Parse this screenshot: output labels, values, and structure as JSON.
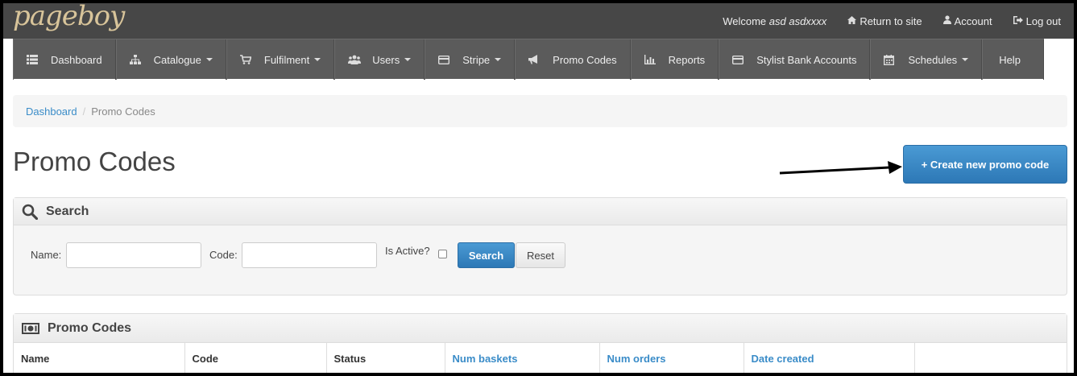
{
  "topbar": {
    "logo": "pageboy",
    "welcome_prefix": "Welcome",
    "welcome_user": "asd asdxxxx",
    "links": [
      {
        "label": "Return to site",
        "icon": "home-icon"
      },
      {
        "label": "Account",
        "icon": "user-icon"
      },
      {
        "label": "Log out",
        "icon": "logout-icon"
      }
    ]
  },
  "mainnav": [
    {
      "label": "Dashboard",
      "icon": "list-icon",
      "dropdown": false
    },
    {
      "label": "Catalogue",
      "icon": "sitemap-icon",
      "dropdown": true
    },
    {
      "label": "Fulfilment",
      "icon": "cart-icon",
      "dropdown": true
    },
    {
      "label": "Users",
      "icon": "users-icon",
      "dropdown": true
    },
    {
      "label": "Stripe",
      "icon": "credit-card-icon",
      "dropdown": true
    },
    {
      "label": "Promo Codes",
      "icon": "bullhorn-icon",
      "dropdown": false
    },
    {
      "label": "Reports",
      "icon": "bar-chart-icon",
      "dropdown": false
    },
    {
      "label": "Stylist Bank Accounts",
      "icon": "credit-card-icon",
      "dropdown": false
    },
    {
      "label": "Schedules",
      "icon": "calendar-icon",
      "dropdown": true
    },
    {
      "label": "Help",
      "icon": "",
      "dropdown": false
    }
  ],
  "breadcrumb": {
    "link": "Dashboard",
    "separator": "/",
    "active": "Promo Codes"
  },
  "page": {
    "title": "Promo Codes",
    "create_button": "+ Create new promo code"
  },
  "search": {
    "title": "Search",
    "name_label": "Name:",
    "code_label": "Code:",
    "active_label": "Is Active?",
    "search_button": "Search",
    "reset_button": "Reset"
  },
  "codes": {
    "title": "Promo Codes",
    "columns": [
      {
        "label": "Name",
        "sortable": false
      },
      {
        "label": "Code",
        "sortable": false
      },
      {
        "label": "Status",
        "sortable": false
      },
      {
        "label": "Num baskets",
        "sortable": true
      },
      {
        "label": "Num orders",
        "sortable": true
      },
      {
        "label": "Date created",
        "sortable": true
      },
      {
        "label": "",
        "sortable": false
      }
    ]
  },
  "colors": {
    "topbar_bg": "#474747",
    "nav_bg": "#5b5b5b",
    "primary": "#3a8cc8",
    "link": "#3a8cc8"
  }
}
